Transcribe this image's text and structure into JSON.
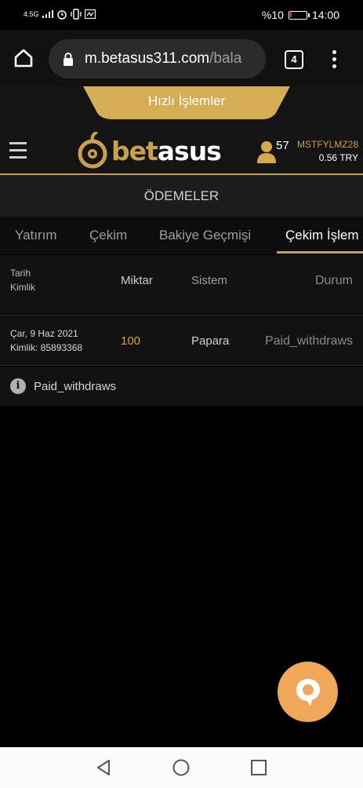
{
  "status_bar": {
    "network": "4.5G",
    "battery": "%10",
    "battery_level": 0.1,
    "time": "14:00"
  },
  "browser": {
    "url_main": "m.betasus311.com",
    "url_rest": "/bala",
    "tab_count": "4"
  },
  "site": {
    "quick_actions_label": "Hızlı İşlemler",
    "logo_bet": "bet",
    "logo_asus": "asus",
    "user_count": "57",
    "username": "MSTFYLMZ28",
    "balance": "0.56 TRY",
    "accent_color": "#c9a14a"
  },
  "page": {
    "heading": "ÖDEMELER",
    "tabs": [
      {
        "label": "Yatırım"
      },
      {
        "label": "Çekim"
      },
      {
        "label": "Bakiye Geçmişi"
      },
      {
        "label": "Çekim İşlem"
      }
    ],
    "active_tab": 3
  },
  "table": {
    "headers": {
      "date": "Tarih",
      "id": "Kimlik",
      "amount": "Miktar",
      "system": "Sistem",
      "status": "Durum"
    },
    "rows": [
      {
        "date": "Çar, 9 Haz 2021",
        "id": "Kimlik: 85893368",
        "amount": "100",
        "system": "Papara",
        "status": "Paid_withdraws"
      }
    ],
    "note": "Paid_withdraws"
  },
  "icons": {
    "home": "home-icon",
    "lock": "lock-icon",
    "tabs": "tabs-icon",
    "menu": "more-vert-icon",
    "hamburger": "hamburger-icon",
    "user": "user-icon",
    "info": "info-icon",
    "chat": "chat-icon",
    "back": "back-icon",
    "home_nav": "home-circle-icon",
    "recents": "recents-icon"
  }
}
